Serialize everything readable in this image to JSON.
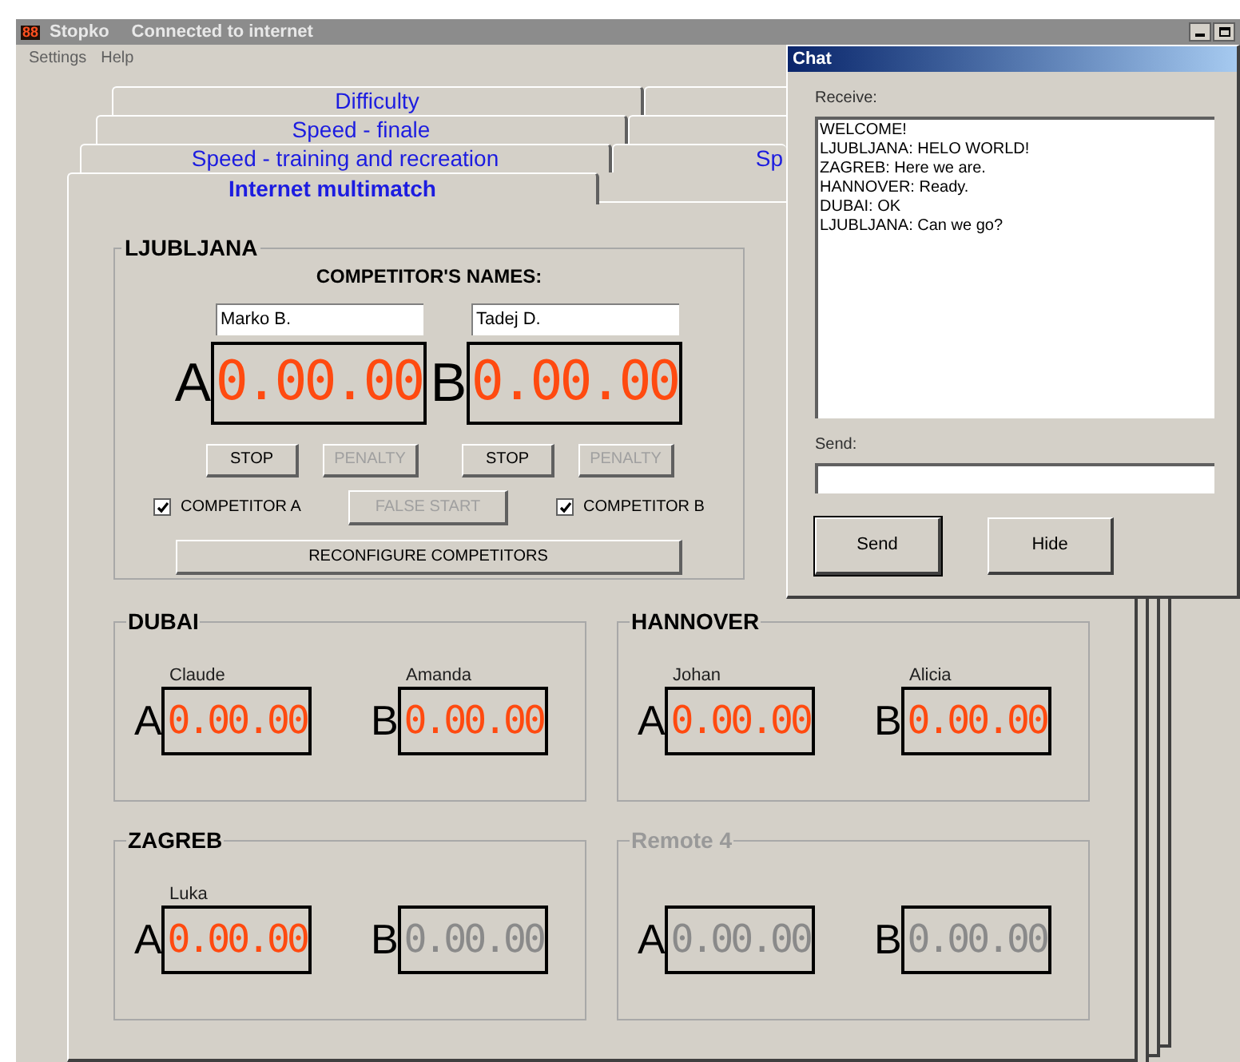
{
  "window": {
    "title": "Stopko",
    "status": "Connected to internet",
    "icon_text": "88"
  },
  "menu": [
    "Settings",
    "Help"
  ],
  "tab_rows": [
    {
      "tabs": [
        {
          "label": "Difficulty",
          "selected": false
        }
      ]
    },
    {
      "tabs": [
        {
          "label": "Speed - finale",
          "selected": false
        }
      ]
    },
    {
      "tabs": [
        {
          "label": "Speed - training and recreation",
          "selected": false
        },
        {
          "label": "Sp",
          "selected": false
        }
      ]
    },
    {
      "tabs": [
        {
          "label": "Internet multimatch",
          "selected": true
        }
      ]
    }
  ],
  "local_station": {
    "name": "LJUBLJANA",
    "heading": "COMPETITOR'S NAMES:",
    "competitors": [
      {
        "letter": "A",
        "name": "Marko B.",
        "time": "0.00.00",
        "active": true,
        "stop": {
          "label": "STOP",
          "disabled": false
        },
        "penalty": {
          "label": "PENALTY",
          "disabled": true
        },
        "checkbox": {
          "label": "COMPETITOR A",
          "checked": true
        }
      },
      {
        "letter": "B",
        "name": "Tadej D.",
        "time": "0.00.00",
        "active": true,
        "stop": {
          "label": "STOP",
          "disabled": false
        },
        "penalty": {
          "label": "PENALTY",
          "disabled": true
        },
        "checkbox": {
          "label": "COMPETITOR B",
          "checked": true
        }
      }
    ],
    "false_start": {
      "label": "FALSE START",
      "disabled": true
    },
    "reconfigure": {
      "label": "RECONFIGURE COMPETITORS",
      "disabled": false
    }
  },
  "remote_stations": [
    {
      "name": "DUBAI",
      "disabled": false,
      "competitors": [
        {
          "letter": "A",
          "name": "Claude",
          "time": "0.00.00",
          "active": true
        },
        {
          "letter": "B",
          "name": "Amanda",
          "time": "0.00.00",
          "active": true
        }
      ]
    },
    {
      "name": "HANNOVER",
      "disabled": false,
      "competitors": [
        {
          "letter": "A",
          "name": "Johan",
          "time": "0.00.00",
          "active": true
        },
        {
          "letter": "B",
          "name": "Alicia",
          "time": "0.00.00",
          "active": true
        }
      ]
    },
    {
      "name": "ZAGREB",
      "disabled": false,
      "competitors": [
        {
          "letter": "A",
          "name": "Luka",
          "time": "0.00.00",
          "active": true
        },
        {
          "letter": "B",
          "time": "0.00.00",
          "active": false
        }
      ]
    },
    {
      "name": "Remote 4",
      "disabled": true,
      "competitors": [
        {
          "letter": "A",
          "time": "0.00.00",
          "active": false
        },
        {
          "letter": "B",
          "time": "0.00.00",
          "active": false
        }
      ]
    }
  ],
  "chat": {
    "title": "Chat",
    "receive_label": "Receive:",
    "messages": [
      "WELCOME!",
      "LJUBLJANA: HELO WORLD!",
      "ZAGREB: Here we are.",
      "HANNOVER: Ready.",
      "DUBAI: OK",
      "LJUBLJANA: Can we go?"
    ],
    "send_label": "Send:",
    "buttons": [
      {
        "label": "Send",
        "focused": true
      },
      {
        "label": "Hide",
        "focused": false
      }
    ]
  }
}
